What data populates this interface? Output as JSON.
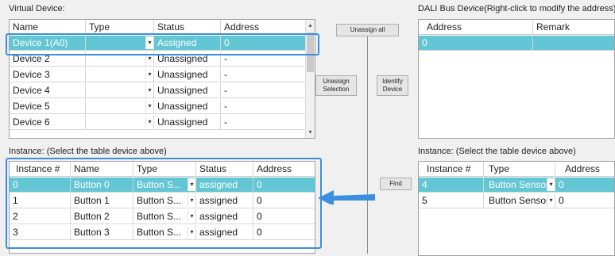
{
  "virtual_device": {
    "title": "Virtual Device:",
    "columns": [
      "Name",
      "Type",
      "Status",
      "Address"
    ],
    "rows": [
      {
        "name": "Device 1(A0)",
        "type": "",
        "status": "Assigned",
        "address": "0"
      },
      {
        "name": "Device 2",
        "type": "",
        "status": "Unassigned",
        "address": "-"
      },
      {
        "name": "Device 3",
        "type": "",
        "status": "Unassigned",
        "address": "-"
      },
      {
        "name": "Device 4",
        "type": "",
        "status": "Unassigned",
        "address": "-"
      },
      {
        "name": "Device 5",
        "type": "",
        "status": "Unassigned",
        "address": "-"
      },
      {
        "name": "Device 6",
        "type": "",
        "status": "Unassigned",
        "address": "-"
      }
    ]
  },
  "instance_left": {
    "title": "Instance:   (Select the table device above)",
    "columns": [
      "Instance #",
      "Name",
      "Type",
      "Status",
      "Address"
    ],
    "rows": [
      {
        "instance": "0",
        "name": "Button 0",
        "type": "Button S...",
        "status": "assigned",
        "address": "0"
      },
      {
        "instance": "1",
        "name": "Button 1",
        "type": "Button S...",
        "status": "assigned",
        "address": "0"
      },
      {
        "instance": "2",
        "name": "Button 2",
        "type": "Button S...",
        "status": "assigned",
        "address": "0"
      },
      {
        "instance": "3",
        "name": "Button 3",
        "type": "Button S...",
        "status": "assigned",
        "address": "0"
      }
    ]
  },
  "dali_bus": {
    "title": "DALI Bus Device(Right-click to modify the address)",
    "columns": [
      "Address",
      "Remark"
    ],
    "rows": [
      {
        "address": "0",
        "remark": ""
      }
    ]
  },
  "instance_right": {
    "title": "Instance:   (Select the table device above)",
    "columns": [
      "Instance #",
      "Type",
      "Address"
    ],
    "rows": [
      {
        "instance": "4",
        "type": "Button Sensor",
        "address": "0"
      },
      {
        "instance": "5",
        "type": "Button Sensor",
        "address": "0"
      }
    ]
  },
  "buttons": {
    "unassign_all": "Unassign all",
    "unassign_selection": "Unassign Selection",
    "identify_device": "Identify Device",
    "find": "Find"
  },
  "icons": {
    "combo_arrow": "▾",
    "scroll_up": "▴",
    "scroll_down": "▾"
  },
  "colors": {
    "selection": "#62c6d4",
    "highlight": "#3a8fe0"
  }
}
